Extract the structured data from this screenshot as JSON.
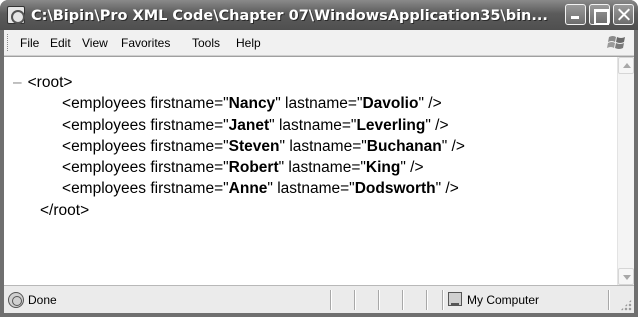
{
  "window": {
    "title": "C:\\Bipin\\Pro XML Code\\Chapter 07\\WindowsApplication35\\bin..."
  },
  "menu": {
    "file": "File",
    "edit": "Edit",
    "view": "View",
    "favorites": "Favorites",
    "tools": "Tools",
    "help": "Help"
  },
  "document": {
    "collapse_marker": "–",
    "root_open": "<root>",
    "root_close": "</root>",
    "element_name": "employees",
    "attr_first": "firstname",
    "attr_last": "lastname",
    "rows": [
      {
        "firstname": "Nancy",
        "lastname": "Davolio"
      },
      {
        "firstname": "Janet",
        "lastname": "Leverling"
      },
      {
        "firstname": "Steven",
        "lastname": "Buchanan"
      },
      {
        "firstname": "Robert",
        "lastname": "King"
      },
      {
        "firstname": "Anne",
        "lastname": "Dodsworth"
      }
    ]
  },
  "status": {
    "text": "Done",
    "zone": "My Computer"
  },
  "icons": {
    "app": "ie-icon",
    "logo": "windows-logo-icon",
    "status": "ie-page-icon",
    "zone": "my-computer-icon"
  }
}
